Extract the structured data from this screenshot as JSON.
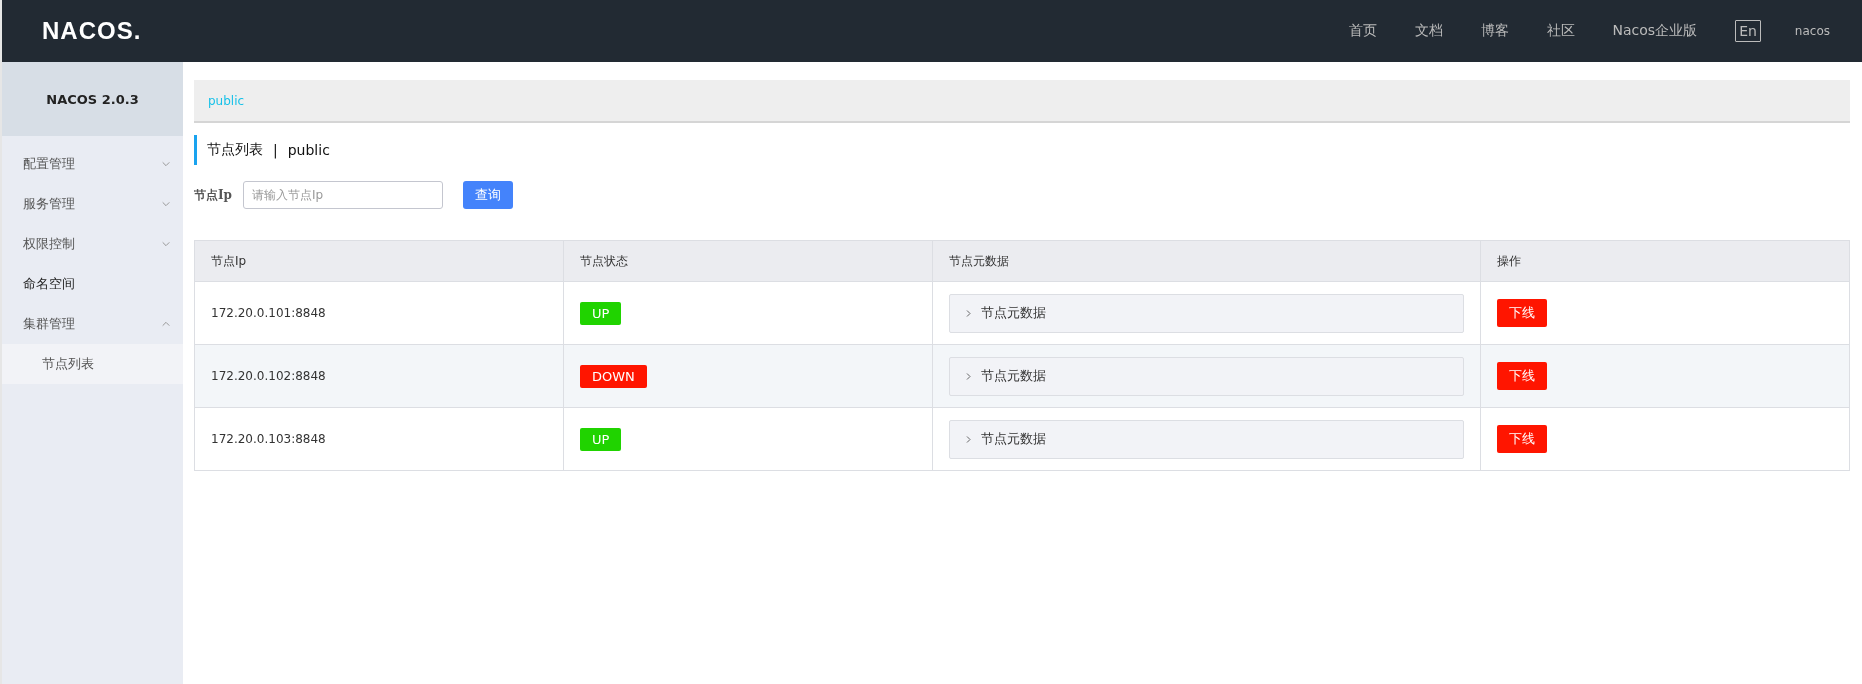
{
  "header": {
    "logo": "NACOS.",
    "nav": [
      "首页",
      "文档",
      "博客",
      "社区",
      "Nacos企业版"
    ],
    "language": "En",
    "user": "nacos"
  },
  "sidebar": {
    "title": "NACOS 2.0.3",
    "items": [
      {
        "label": "配置管理",
        "kind": "group",
        "expanded": false
      },
      {
        "label": "服务管理",
        "kind": "group",
        "expanded": false
      },
      {
        "label": "权限控制",
        "kind": "group",
        "expanded": false
      },
      {
        "label": "命名空间",
        "kind": "link"
      },
      {
        "label": "集群管理",
        "kind": "group",
        "expanded": true,
        "children": [
          {
            "label": "节点列表",
            "selected": true
          }
        ]
      }
    ]
  },
  "breadcrumb": "public",
  "page_title": {
    "title": "节点列表",
    "separator": "|",
    "namespace": "public"
  },
  "search": {
    "label": "节点Ip",
    "placeholder": "请输入节点Ip",
    "button": "查询"
  },
  "table": {
    "columns": [
      "节点Ip",
      "节点状态",
      "节点元数据",
      "操作"
    ],
    "rows": [
      {
        "ip": "172.20.0.101:8848",
        "status": "UP",
        "kind": "up",
        "metadata": "节点元数据",
        "action": "下线"
      },
      {
        "ip": "172.20.0.102:8848",
        "status": "DOWN",
        "kind": "down",
        "metadata": "节点元数据",
        "action": "下线"
      },
      {
        "ip": "172.20.0.103:8848",
        "status": "UP",
        "kind": "up",
        "metadata": "节点元数据",
        "action": "下线"
      }
    ]
  }
}
